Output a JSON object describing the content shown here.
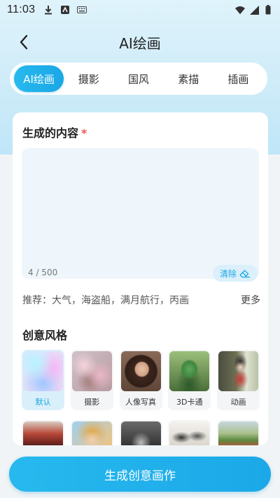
{
  "status": {
    "time": "11:03"
  },
  "header": {
    "title": "AI绘画"
  },
  "tabs": [
    {
      "label": "AI绘画",
      "active": true
    },
    {
      "label": "摄影"
    },
    {
      "label": "国风"
    },
    {
      "label": "素描"
    },
    {
      "label": "插画"
    }
  ],
  "content": {
    "title": "生成的内容",
    "required_mark": "*",
    "count": "4 / 500",
    "clear_label": "清除",
    "recommend_label": "推荐：大气，海盗船，满月航行，丙画",
    "more_label": "更多"
  },
  "styles": {
    "title": "创意风格",
    "items": [
      {
        "label": "默认",
        "active": true
      },
      {
        "label": "摄影"
      },
      {
        "label": "人像写真"
      },
      {
        "label": "3D卡通"
      },
      {
        "label": "动画"
      }
    ]
  },
  "generate_button": "生成创意画作",
  "colors": {
    "accent": "#1ba8e8",
    "required": "#f25757"
  }
}
